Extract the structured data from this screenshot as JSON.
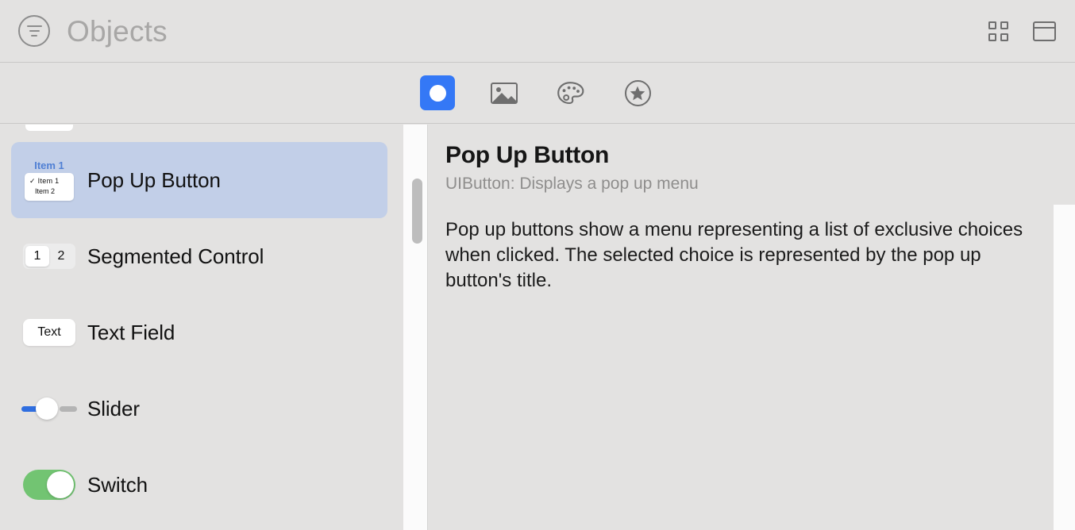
{
  "header": {
    "title": "Objects",
    "filter_icon": "filter-lines-circle-icon",
    "right_icons": [
      {
        "name": "grid-view-icon"
      },
      {
        "name": "panel-view-icon"
      }
    ]
  },
  "tabbar": {
    "tabs": [
      {
        "name": "objects-tab",
        "icon": "filled-circle-icon",
        "active": true
      },
      {
        "name": "images-tab",
        "icon": "photo-icon",
        "active": false
      },
      {
        "name": "colors-tab",
        "icon": "palette-icon",
        "active": false
      },
      {
        "name": "favorites-tab",
        "icon": "star-circle-icon",
        "active": false
      }
    ]
  },
  "list": {
    "items": [
      {
        "label": "Pop Up Button",
        "selected": true,
        "preview": {
          "type": "popup-button",
          "title": "Item 1",
          "menu_items": [
            {
              "text": "Item 1",
              "checked": true
            },
            {
              "text": "Item 2",
              "checked": false
            }
          ]
        }
      },
      {
        "label": "Segmented Control",
        "selected": false,
        "preview": {
          "type": "segmented-control",
          "segments": [
            "1",
            "2"
          ],
          "selected_index": 0
        }
      },
      {
        "label": "Text Field",
        "selected": false,
        "preview": {
          "type": "text-field",
          "value": "Text"
        }
      },
      {
        "label": "Slider",
        "selected": false,
        "preview": {
          "type": "slider",
          "value_percent": 35
        }
      },
      {
        "label": "Switch",
        "selected": false,
        "preview": {
          "type": "switch",
          "on": true
        }
      }
    ]
  },
  "detail": {
    "title": "Pop Up Button",
    "subtitle": "UIButton: Displays a pop up menu",
    "body": "Pop up buttons show a menu representing a list of exclusive choices when clicked. The selected choice is represented by the pop up button's title."
  },
  "colors": {
    "background": "#e3e2e1",
    "selection": "#c2cfe8",
    "accent_blue": "#3478f6",
    "popup_title_blue": "#4f7fd4",
    "slider_blue": "#2f6ee0",
    "switch_green": "#72c472",
    "title_grey": "#a8a7a6",
    "subtitle_grey": "#8f8e8d",
    "icon_grey": "#6e6e6e"
  }
}
